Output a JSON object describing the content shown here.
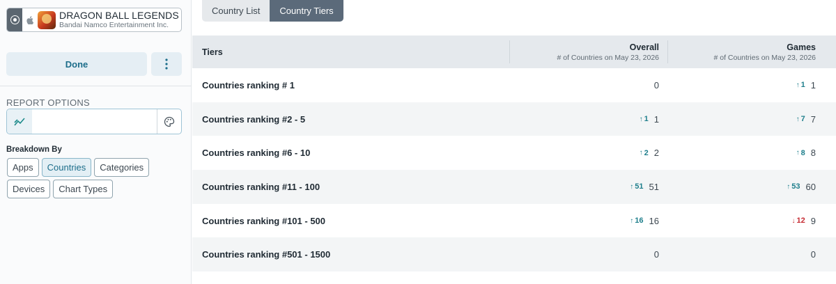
{
  "app": {
    "name": "DRAGON BALL LEGENDS",
    "publisher": "Bandai Namco Entertainment Inc."
  },
  "sidebar": {
    "done_label": "Done",
    "report_options_title": "REPORT OPTIONS",
    "breakdown_title": "Breakdown By",
    "breakdown_options": [
      {
        "label": "Apps",
        "active": false
      },
      {
        "label": "Countries",
        "active": true
      },
      {
        "label": "Categories",
        "active": false
      },
      {
        "label": "Devices",
        "active": false
      },
      {
        "label": "Chart Types",
        "active": false
      }
    ]
  },
  "tabs": [
    {
      "label": "Country List",
      "active": false
    },
    {
      "label": "Country Tiers",
      "active": true
    }
  ],
  "table": {
    "headers": {
      "tiers": "Tiers",
      "overall": "Overall",
      "overall_sub": "# of Countries on May 23, 2026",
      "games": "Games",
      "games_sub": "# of Countries on May 23, 2026"
    },
    "rows": [
      {
        "tier": "Countries ranking # 1",
        "overall_delta": "",
        "overall_dir": "",
        "overall": "0",
        "games_delta": "1",
        "games_dir": "up",
        "games": "1"
      },
      {
        "tier": "Countries ranking #2 - 5",
        "overall_delta": "1",
        "overall_dir": "up",
        "overall": "1",
        "games_delta": "7",
        "games_dir": "up",
        "games": "7"
      },
      {
        "tier": "Countries ranking #6 - 10",
        "overall_delta": "2",
        "overall_dir": "up",
        "overall": "2",
        "games_delta": "8",
        "games_dir": "up",
        "games": "8"
      },
      {
        "tier": "Countries ranking #11 - 100",
        "overall_delta": "51",
        "overall_dir": "up",
        "overall": "51",
        "games_delta": "53",
        "games_dir": "up",
        "games": "60"
      },
      {
        "tier": "Countries ranking #101 - 500",
        "overall_delta": "16",
        "overall_dir": "up",
        "overall": "16",
        "games_delta": "12",
        "games_dir": "down",
        "games": "9"
      },
      {
        "tier": "Countries ranking #501 - 1500",
        "overall_delta": "",
        "overall_dir": "",
        "overall": "0",
        "games_delta": "",
        "games_dir": "",
        "games": "0"
      }
    ]
  },
  "colors": {
    "accent": "#1c6d8a",
    "up": "#1f7f8c",
    "down": "#c62b33",
    "tab_active": "#5b6a7a"
  }
}
